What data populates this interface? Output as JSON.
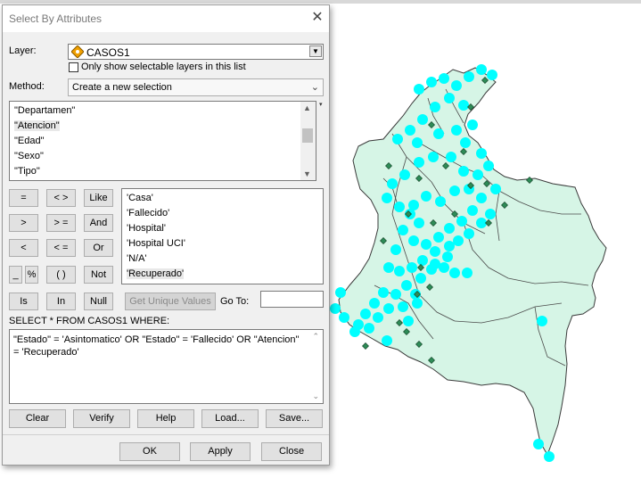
{
  "dialog": {
    "title": "Select By Attributes",
    "layer_label": "Layer:",
    "layer_value": "CASOS1",
    "only_selectable_label": "Only show selectable layers in this list",
    "method_label": "Method:",
    "method_value": "Create a new selection",
    "fields": [
      "\"Departamen\"",
      "\"Atencion\"",
      "\"Edad\"",
      "\"Sexo\"",
      "\"Tipo\""
    ],
    "operators": {
      "eq": "=",
      "ne": "< >",
      "like": "Like",
      "gt": ">",
      "ge": "> =",
      "and": "And",
      "lt": "<",
      "le": "< =",
      "or": "Or",
      "underscore": "_",
      "percent": "%",
      "parens": "( )",
      "not": "Not",
      "is": "Is",
      "in": "In",
      "null": "Null"
    },
    "values": [
      "'Casa'",
      "'Fallecido'",
      "'Hospital'",
      "'Hospital UCI'",
      "'N/A'",
      "'Recuperado'"
    ],
    "get_unique_values": "Get Unique Values",
    "go_to_label": "Go To:",
    "go_to_value": "",
    "select_prefix": "SELECT * FROM CASOS1 WHERE:",
    "where_clause": "\"Estado\" = 'Asintomatico' OR \"Estado\" = 'Fallecido' OR \"Atencion\" = 'Recuperado'",
    "buttons": {
      "clear": "Clear",
      "verify": "Verify",
      "help": "Help",
      "load": "Load...",
      "save": "Save...",
      "ok": "OK",
      "apply": "Apply",
      "close": "Close"
    }
  },
  "colors": {
    "map_fill": "#d6f5e6",
    "map_border": "#3a3a3a",
    "point_cyan": "#00ffff",
    "point_green": "#2e8b57",
    "layer_icon": "#f0a000"
  },
  "icons": {
    "close": "close-icon",
    "dropdown": "chevron-down-icon",
    "layer": "layer-diamond-icon"
  }
}
